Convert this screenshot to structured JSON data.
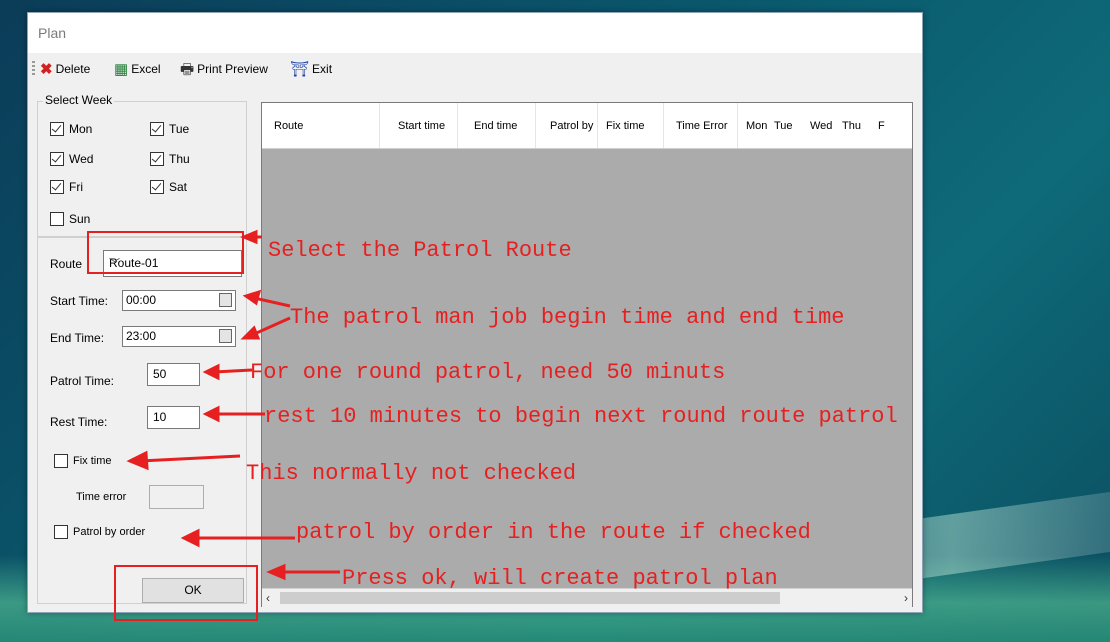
{
  "window": {
    "title": "Plan"
  },
  "toolbar": {
    "delete_label": "Delete",
    "excel_label": "Excel",
    "print_preview_label": "Print Preview",
    "exit_label": "Exit"
  },
  "select_week": {
    "legend": "Select Week",
    "days": [
      {
        "label": "Mon",
        "checked": true
      },
      {
        "label": "Tue",
        "checked": true
      },
      {
        "label": "Wed",
        "checked": true
      },
      {
        "label": "Thu",
        "checked": true
      },
      {
        "label": "Fri",
        "checked": true
      },
      {
        "label": "Sat",
        "checked": true
      },
      {
        "label": "Sun",
        "checked": false
      }
    ]
  },
  "form": {
    "route_label": "Route",
    "route_value": "Route-01",
    "start_time_label": "Start Time:",
    "start_time_value": "00:00",
    "end_time_label": "End Time:",
    "end_time_value": "23:00",
    "patrol_time_label": "Patrol Time:",
    "patrol_time_value": "50",
    "rest_time_label": "Rest Time:",
    "rest_time_value": "10",
    "fix_time_label": "Fix time",
    "fix_time_checked": false,
    "time_error_label": "Time error",
    "patrol_by_order_label": "Patrol by order",
    "patrol_by_order_checked": false,
    "ok_label": "OK"
  },
  "grid": {
    "columns": [
      "Route",
      "Start time",
      "End time",
      "Patrol by",
      "Fix time",
      "Time Error",
      "Mon",
      "Tue",
      "Wed",
      "Thu",
      "F"
    ]
  },
  "annotations": {
    "route": "Select the Patrol Route",
    "time": "The patrol man job begin time and end time",
    "patrol": "For one round patrol, need 50 minuts",
    "rest": "rest 10 minutes to begin next round route patrol",
    "fix": "This normally not checked",
    "order": "patrol by order in the route if checked",
    "ok": "Press ok, will create patrol plan"
  },
  "colors": {
    "annotation": "#e62020",
    "grid_background": "#ababab"
  }
}
